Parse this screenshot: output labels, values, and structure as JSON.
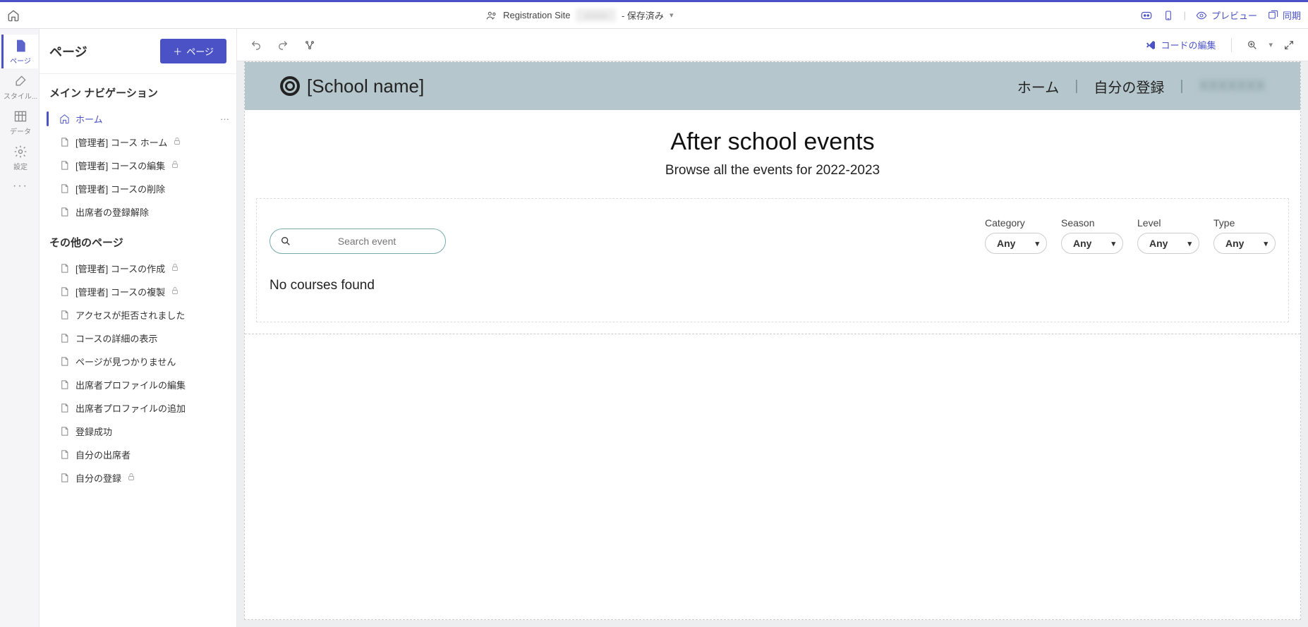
{
  "topbar": {
    "title_prefix": "Registration Site",
    "saved_suffix": "- 保存済み",
    "preview": "プレビュー",
    "sync": "同期"
  },
  "rail": {
    "pages": "ページ",
    "styles": "スタイル...",
    "data": "データ",
    "settings": "設定"
  },
  "sidebar": {
    "heading": "ページ",
    "add_page": "ページ",
    "section_main_nav": "メイン ナビゲーション",
    "section_other": "その他のページ",
    "nav_items": [
      {
        "label": "ホーム",
        "icon": "home",
        "selected": true,
        "lock": false,
        "dots": true
      },
      {
        "label": "[管理者] コース ホーム",
        "icon": "page",
        "selected": false,
        "lock": true
      },
      {
        "label": "[管理者] コースの編集",
        "icon": "page",
        "selected": false,
        "lock": true
      },
      {
        "label": "[管理者] コースの削除",
        "icon": "page",
        "selected": false,
        "lock": false
      },
      {
        "label": "出席者の登録解除",
        "icon": "page",
        "selected": false,
        "lock": false
      }
    ],
    "other_items": [
      {
        "label": "[管理者] コースの作成",
        "lock": true
      },
      {
        "label": "[管理者] コースの複製",
        "lock": true
      },
      {
        "label": "アクセスが拒否されました",
        "lock": false
      },
      {
        "label": "コースの詳細の表示",
        "lock": false
      },
      {
        "label": "ページが見つかりません",
        "lock": false
      },
      {
        "label": "出席者プロファイルの編集",
        "lock": false
      },
      {
        "label": "出席者プロファイルの追加",
        "lock": false
      },
      {
        "label": "登録成功",
        "lock": false
      },
      {
        "label": "自分の出席者",
        "lock": false
      },
      {
        "label": "自分の登録",
        "lock": true
      }
    ]
  },
  "editorbar": {
    "edit_code": "コードの編集"
  },
  "site": {
    "brand": "[School name]",
    "nav_home": "ホーム",
    "nav_myreg": "自分の登録",
    "hero_title": "After school events",
    "hero_sub": "Browse all the events for 2022-2023",
    "search_placeholder": "Search event",
    "filters": {
      "category": {
        "label": "Category",
        "value": "Any"
      },
      "season": {
        "label": "Season",
        "value": "Any"
      },
      "level": {
        "label": "Level",
        "value": "Any"
      },
      "type": {
        "label": "Type",
        "value": "Any"
      }
    },
    "no_courses": "No courses found"
  }
}
